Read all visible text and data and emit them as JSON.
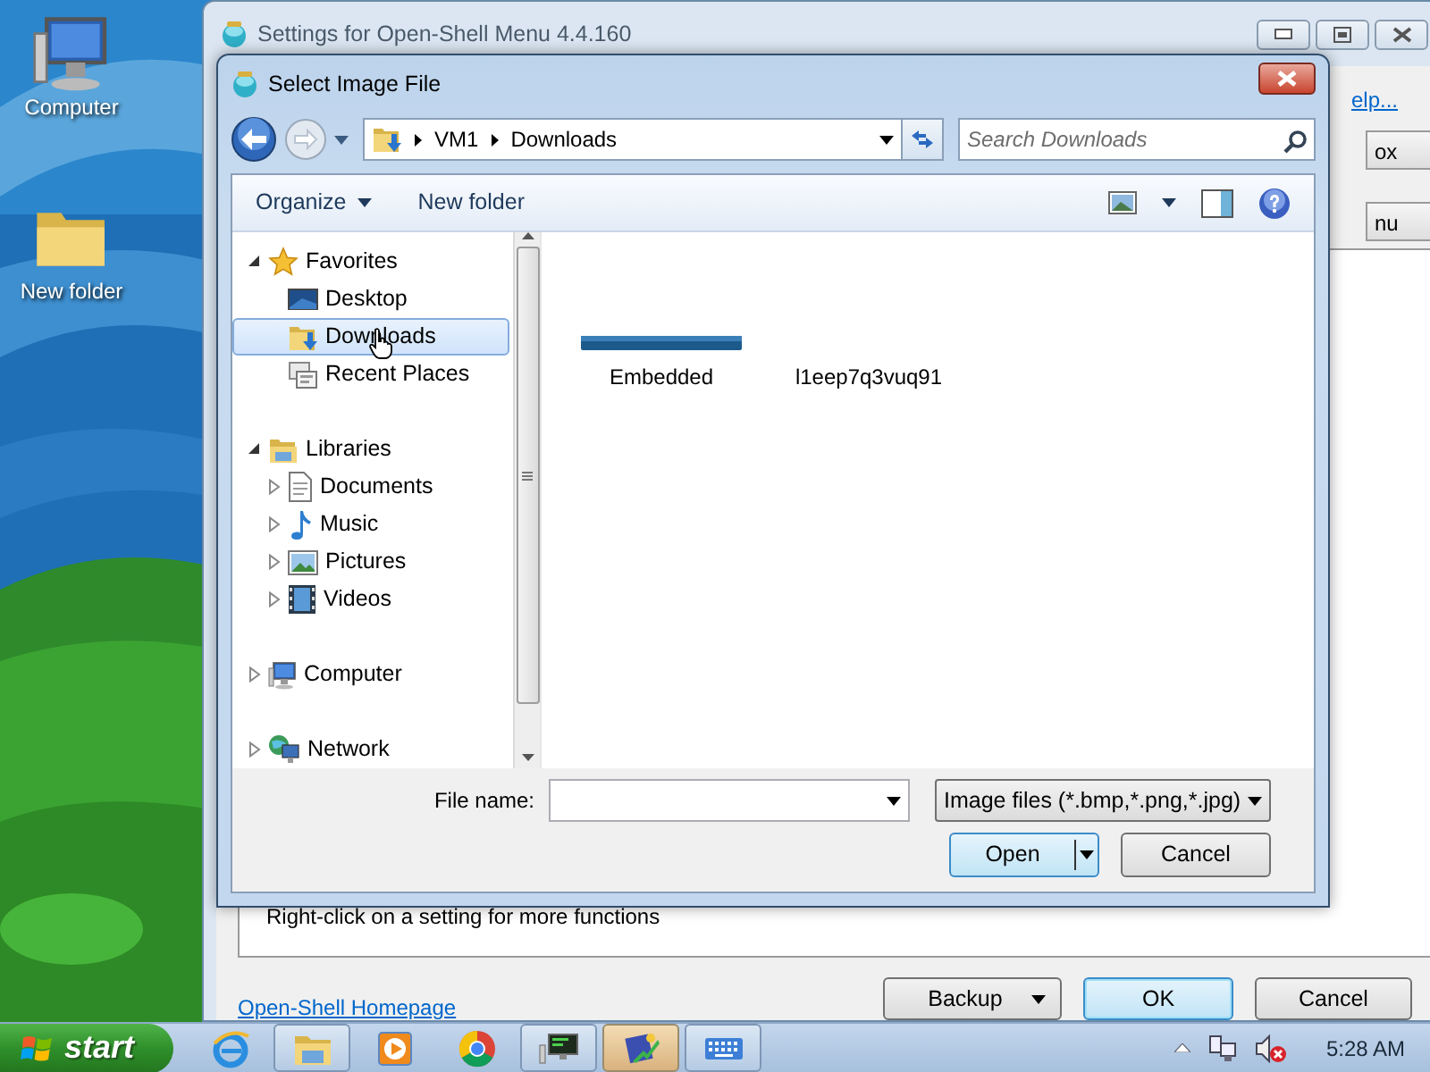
{
  "desktop": {
    "icons": [
      {
        "label": "Computer",
        "kind": "computer"
      },
      {
        "label": "New folder",
        "kind": "folder"
      }
    ]
  },
  "settings_window": {
    "title": "Settings for Open-Shell Menu 4.4.160",
    "help_link": "elp...",
    "tabs": [
      {
        "label": "ox"
      },
      {
        "label": "nu"
      }
    ],
    "hint": "Right-click on a setting for more functions",
    "homepage_link": "Open-Shell Homepage",
    "buttons": [
      {
        "label": "Backup",
        "kind": "dropdown"
      },
      {
        "label": "OK",
        "kind": "default"
      },
      {
        "label": "Cancel",
        "kind": "plain"
      }
    ]
  },
  "dialog": {
    "title": "Select Image File",
    "path": [
      "VM1",
      "Downloads"
    ],
    "search": {
      "placeholder": "Search Downloads"
    },
    "toolbar": [
      {
        "label": "Organize",
        "kind": "menu"
      },
      {
        "label": "New folder",
        "kind": "plain"
      }
    ],
    "nav_tree": [
      {
        "label": "Favorites",
        "kind": "favorites",
        "expanded": true,
        "selected": false,
        "children": [
          {
            "label": "Desktop",
            "kind": "desktop",
            "selected": false
          },
          {
            "label": "Downloads",
            "kind": "downloads",
            "selected": true
          },
          {
            "label": "Recent Places",
            "kind": "recent",
            "selected": false
          }
        ]
      },
      {
        "label": "Libraries",
        "kind": "libraries",
        "expanded": true,
        "selected": false,
        "children": [
          {
            "label": "Documents",
            "kind": "documents",
            "expanded": false,
            "selected": false
          },
          {
            "label": "Music",
            "kind": "music",
            "expanded": false,
            "selected": false
          },
          {
            "label": "Pictures",
            "kind": "pictures",
            "expanded": false,
            "selected": false
          },
          {
            "label": "Videos",
            "kind": "videos",
            "expanded": false,
            "selected": false
          }
        ]
      },
      {
        "label": "Computer",
        "kind": "computer",
        "expanded": false,
        "selected": false
      },
      {
        "label": "Network",
        "kind": "network",
        "expanded": false,
        "selected": false
      }
    ],
    "files": [
      {
        "label": "Embedded"
      },
      {
        "label": "l1eep7q3vuq91",
        "kind": "blank"
      }
    ],
    "file_name_label": "File name:",
    "file_type": "Image files (*.bmp,*.png,*.jpg)",
    "buttons": [
      {
        "label": "Open",
        "kind": "split"
      },
      {
        "label": "Cancel",
        "kind": "plain"
      }
    ]
  },
  "taskbar": {
    "start": "start",
    "apps": [
      {
        "kind": "browser",
        "running": false,
        "selected": false
      },
      {
        "kind": "folder",
        "running": true,
        "selected": false
      },
      {
        "kind": "media",
        "running": false,
        "selected": false
      },
      {
        "kind": "round",
        "running": false,
        "selected": false
      },
      {
        "kind": "monitor",
        "running": true,
        "selected": false
      },
      {
        "kind": "settings",
        "running": true,
        "selected": true
      },
      {
        "kind": "keyboard",
        "running": true,
        "selected": false
      }
    ],
    "clock": "5:28 AM"
  }
}
